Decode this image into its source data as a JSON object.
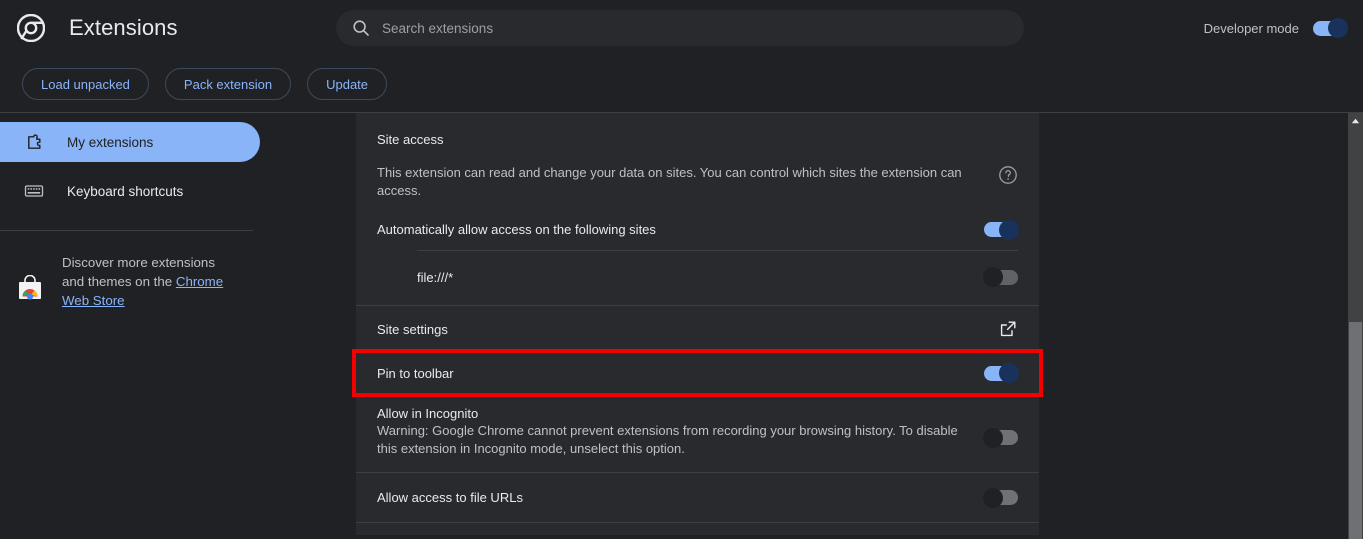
{
  "header": {
    "logo_icon": "chrome-logo-icon",
    "title": "Extensions",
    "search": {
      "icon": "search-icon",
      "placeholder": "Search extensions",
      "value": ""
    },
    "developer_mode": {
      "label": "Developer mode",
      "state": "on"
    }
  },
  "toolbar": {
    "load_unpacked": "Load unpacked",
    "pack_extension": "Pack extension",
    "update": "Update"
  },
  "sidebar": {
    "items": [
      {
        "label": "My extensions",
        "icon": "puzzle-piece-icon",
        "selected": true
      },
      {
        "label": "Keyboard shortcuts",
        "icon": "keyboard-icon",
        "selected": false
      }
    ],
    "store_promo": {
      "icon": "chrome-web-store-icon",
      "text_before": "Discover more extensions and themes on the ",
      "link": "Chrome Web Store"
    }
  },
  "main": {
    "site_access": {
      "title": "Site access",
      "description": "This extension can read and change your data on sites. You can control which sites the extension can access.",
      "help_icon": "help-circle-icon",
      "auto_allow_label": "Automatically allow access on the following sites",
      "auto_allow_state": "on",
      "hosts": [
        {
          "label": "file:///*",
          "state": "off"
        }
      ]
    },
    "site_settings": {
      "label": "Site settings",
      "icon": "external-link-icon"
    },
    "pin_to_toolbar": {
      "label": "Pin to toolbar",
      "state": "on",
      "highlighted": true,
      "highlight_color": "#f40000"
    },
    "allow_incognito": {
      "title": "Allow in Incognito",
      "warning": "Warning: Google Chrome cannot prevent extensions from recording your browsing history. To disable this extension in Incognito mode, unselect this option.",
      "state": "off"
    },
    "allow_file_urls": {
      "label": "Allow access to file URLs",
      "state": "off"
    }
  },
  "scrollbar": {
    "up_arrow_icon": "chevron-up-icon",
    "position": "mid"
  },
  "colors": {
    "background": "#202124",
    "card": "#292a2d",
    "accent": "#8ab4f8",
    "text_primary": "#e8eaed",
    "text_secondary": "#bdc1c6",
    "divider": "#3c4043",
    "highlight": "#f40000"
  }
}
